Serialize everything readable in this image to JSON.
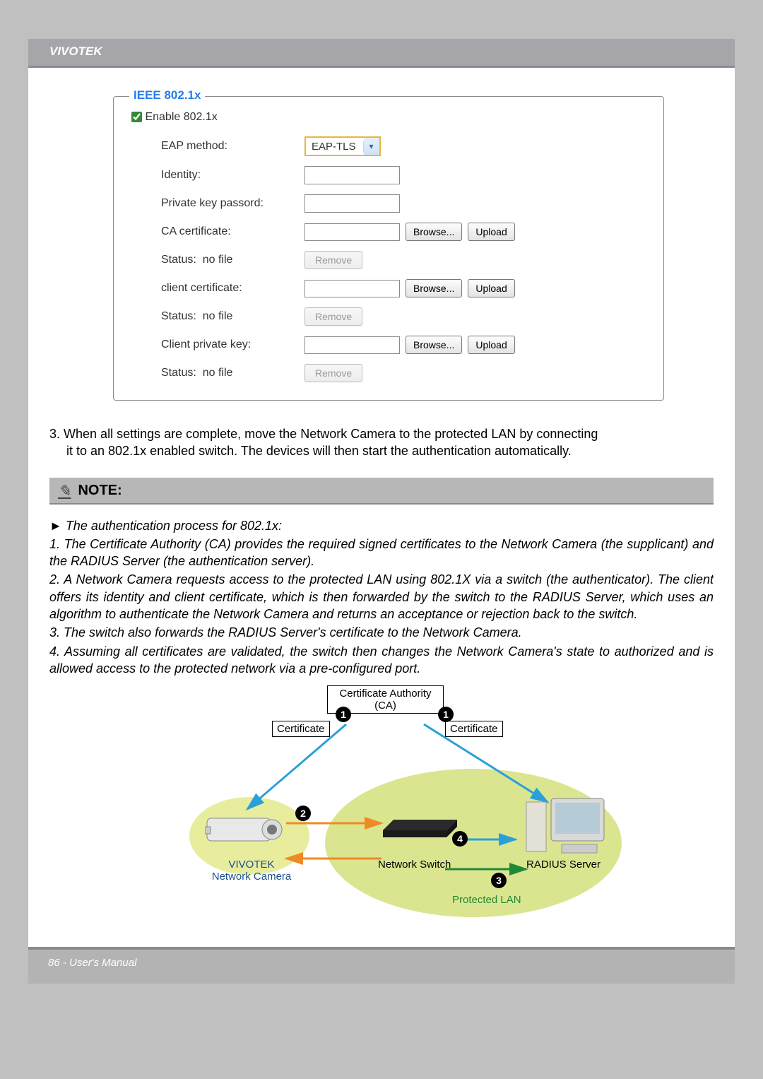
{
  "header": {
    "brand": "VIVOTEK"
  },
  "form": {
    "legend": "IEEE 802.1x",
    "enable_label": "Enable 802.1x",
    "enable_checked": true,
    "eap_method_label": "EAP method:",
    "eap_method_value": "EAP-TLS",
    "identity_label": "Identity:",
    "identity_value": "",
    "pk_pass_label": "Private key passord:",
    "pk_pass_value": "",
    "ca_cert_label": "CA certificate:",
    "client_cert_label": "client certificate:",
    "client_pk_label": "Client private key:",
    "status_label": "Status:",
    "status_value": "no file",
    "browse_label": "Browse...",
    "upload_label": "Upload",
    "remove_label": "Remove"
  },
  "body": {
    "step3_num": "3.",
    "step3_a": "When all settings are complete, move the Network Camera to the protected LAN by connecting",
    "step3_b": "it to an 802.1x enabled switch. The devices will then start the authentication automatically."
  },
  "note": {
    "title": "NOTE:",
    "intro": "► The authentication process for 802.1x:",
    "p1": "1. The Certificate Authority (CA) provides the required signed certificates to the Network Camera (the supplicant) and the RADIUS Server (the authentication server).",
    "p2": "2. A Network Camera requests access to the protected LAN using 802.1X via a switch (the authenticator). The client offers its identity and client certificate, which is then forwarded by the switch to the RADIUS Server, which uses an algorithm to authenticate the Network Camera and returns an acceptance or rejection back to the switch.",
    "p3": "3. The switch also forwards the RADIUS Server's certificate to the Network Camera.",
    "p4": "4. Assuming all certificates are validated, the switch then changes the Network Camera's state to authorized and is allowed access to the protected network via a pre-configured port."
  },
  "diagram": {
    "ca": "Certificate Authority\n(CA)",
    "certificate": "Certificate",
    "camera": "VIVOTEK\nNetwork Camera",
    "switch": "Network Switch",
    "radius": "RADIUS Server",
    "protected": "Protected LAN",
    "n1": "1",
    "n2": "2",
    "n3": "3",
    "n4": "4"
  },
  "footer": {
    "page": "86 - User's Manual"
  }
}
